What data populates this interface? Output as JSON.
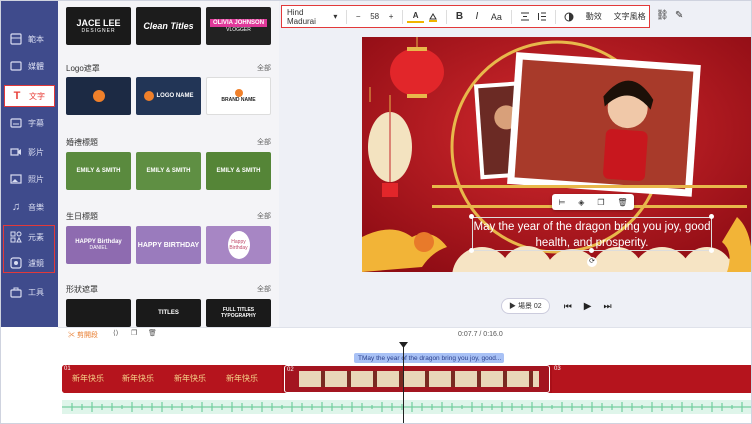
{
  "sidebar": {
    "items": [
      {
        "label": "範本",
        "icon": "template-icon"
      },
      {
        "label": "媒體",
        "icon": "media-icon"
      },
      {
        "label": "文字",
        "icon": "text-icon"
      },
      {
        "label": "字幕",
        "icon": "subtitle-icon"
      },
      {
        "label": "影片",
        "icon": "video-icon"
      },
      {
        "label": "照片",
        "icon": "photo-icon"
      },
      {
        "label": "音樂",
        "icon": "music-icon"
      },
      {
        "label": "元素",
        "icon": "elements-icon"
      },
      {
        "label": "濾鏡",
        "icon": "filter-icon"
      },
      {
        "label": "工具",
        "icon": "tools-icon"
      }
    ]
  },
  "panel": {
    "top_thumbs": [
      "JACE LEE",
      "DESIGNER",
      "Clean Titles",
      "OLIVIA JOHNSON",
      "VLOGGER"
    ],
    "logo": {
      "title": "Logo遮罩",
      "more": "全部",
      "thumbs": [
        "LOGO",
        "LOGO NAME",
        "BRAND NAME"
      ]
    },
    "wedding": {
      "title": "婚禮標題",
      "more": "全部",
      "thumbs": [
        "EMILY & SMITH",
        "EMILY & SMITH",
        "EMILY & SMITH"
      ]
    },
    "birthday": {
      "title": "生日標題",
      "more": "全部",
      "thumbs": [
        "HAPPY Birthday",
        "DANIEL",
        "HAPPY BIRTHDAY",
        "Happy Birthday"
      ]
    },
    "shape": {
      "title": "形狀遮罩",
      "more": "全部",
      "thumbs": [
        "TITLES",
        "FULL TITLES TYPOGRAPHY"
      ]
    }
  },
  "toolbar": {
    "font": "Hind Madurai",
    "font_size": "58",
    "minus": "−",
    "plus": "+",
    "bold": "B",
    "italic": "I",
    "case": "Aa",
    "animation": "動效",
    "text_style": "文字風格"
  },
  "canvas": {
    "text": "May the year of the dragon bring you joy, good health, and prosperity."
  },
  "player": {
    "scene": "場景 02"
  },
  "timeline": {
    "split_label": "剪開段",
    "time": "0:07.7 / 0:16.0",
    "caption": "May the year of the dragon bring you joy, good...",
    "scene_numbers": [
      "01",
      "02",
      "03"
    ],
    "greeting": "新年快乐"
  },
  "colors": {
    "sidebar": "#3f4b8c",
    "accent": "#e2393a",
    "canvas_bg": "#b0121c",
    "caption": "#a8c1f5"
  }
}
